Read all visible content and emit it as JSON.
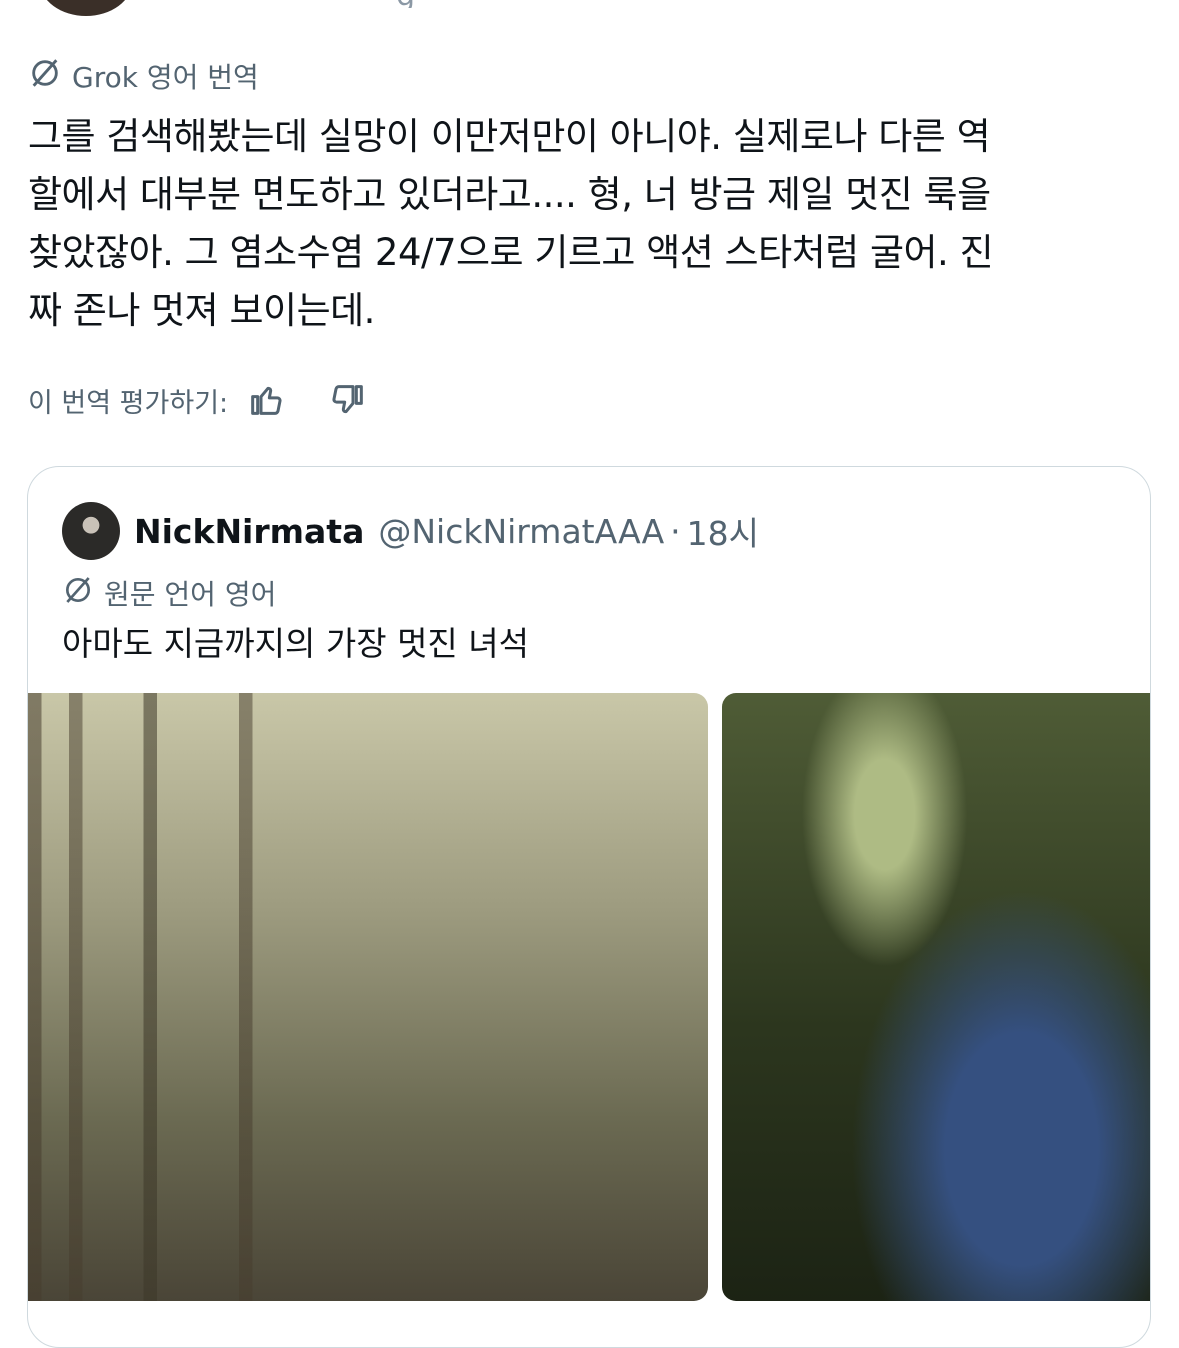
{
  "top": {
    "text_fragment": "g"
  },
  "translation": {
    "label": "Grok 영어 번역",
    "icon": "translate-icon"
  },
  "tweet": {
    "text": "그를 검색해봤는데 실망이 이만저만이 아니야. 실제로나 다른 역\n할에서 대부분 면도하고 있더라고.... 형, 너 방금 제일 멋진 룩을\n찾았잖아. 그 염소수염 24/7으로 기르고 액션 스타처럼 굴어. 진\n짜 존나 멋져 보이는데."
  },
  "rating": {
    "label": "이 번역 평가하기:",
    "like_icon": "thumbs-up-icon",
    "dislike_icon": "thumbs-down-icon"
  },
  "quote": {
    "display_name": "NickNirmata",
    "handle": "@NickNirmatAAA",
    "separator": "·",
    "time": "18시",
    "lang_label": "원문 언어 영어",
    "text": "아마도 지금까지의 가장 멋진 녀석"
  },
  "colors": {
    "text_primary": "#0f1419",
    "text_secondary": "#536471",
    "border": "#cfd9de"
  }
}
